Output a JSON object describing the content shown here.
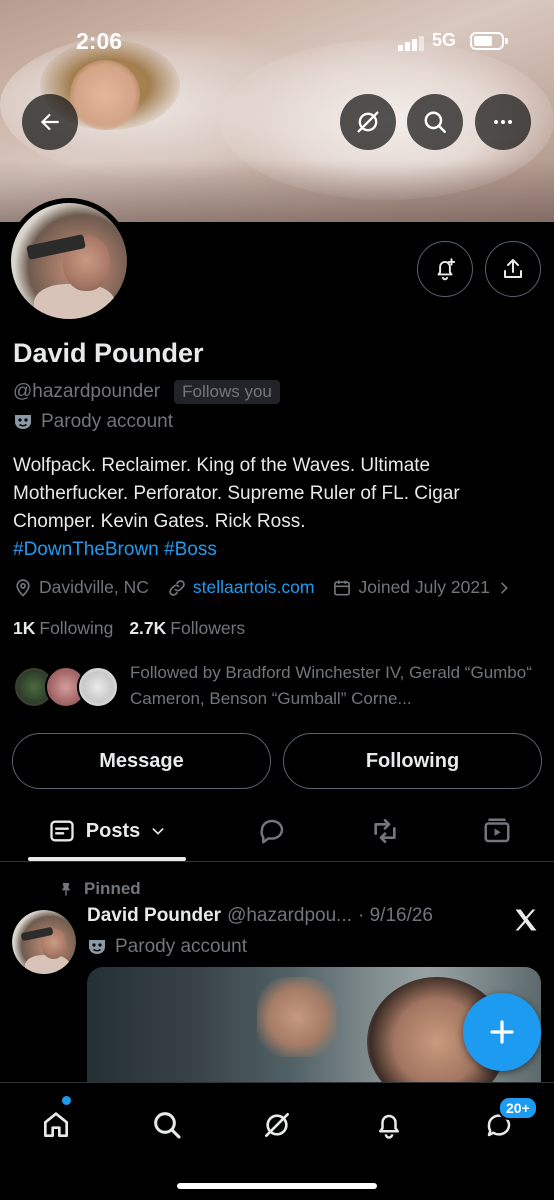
{
  "status_bar": {
    "time": "2:06",
    "network": "5G"
  },
  "profile": {
    "name": "David Pounder",
    "handle": "@hazardpounder",
    "follows_you": "Follows you",
    "parody_label": "Parody account",
    "bio_text": "Wolfpack. Reclaimer. King of the Waves. Ultimate Motherfucker. Perforator. Supreme Ruler of FL. Cigar Chomper. Kevin Gates. Rick Ross.",
    "bio_tags": [
      "#DownTheBrown",
      "#Boss"
    ],
    "location": "Davidville, NC",
    "website": "stellaartois.com",
    "joined": "Joined July 2021",
    "following_count": "1K",
    "following_label": "Following",
    "followers_count": "2.7K",
    "followers_label": "Followers",
    "followed_by": "Followed by Bradford Winchester IV, Gerald “Gumbo“ Cameron, Benson “Gumball” Corne..."
  },
  "actions": {
    "message": "Message",
    "following": "Following"
  },
  "tabs": {
    "posts": "Posts"
  },
  "pinned_post": {
    "pinned_label": "Pinned",
    "author_name": "David Pounder",
    "author_handle": "@hazardpou...",
    "date": "· 9/16/26",
    "parody_label": "Parody account"
  },
  "bottom_nav": {
    "messages_badge": "20+"
  },
  "colors": {
    "accent": "#1d9bf0",
    "background": "#000000",
    "secondary_text": "#71767b",
    "border": "#536471"
  }
}
